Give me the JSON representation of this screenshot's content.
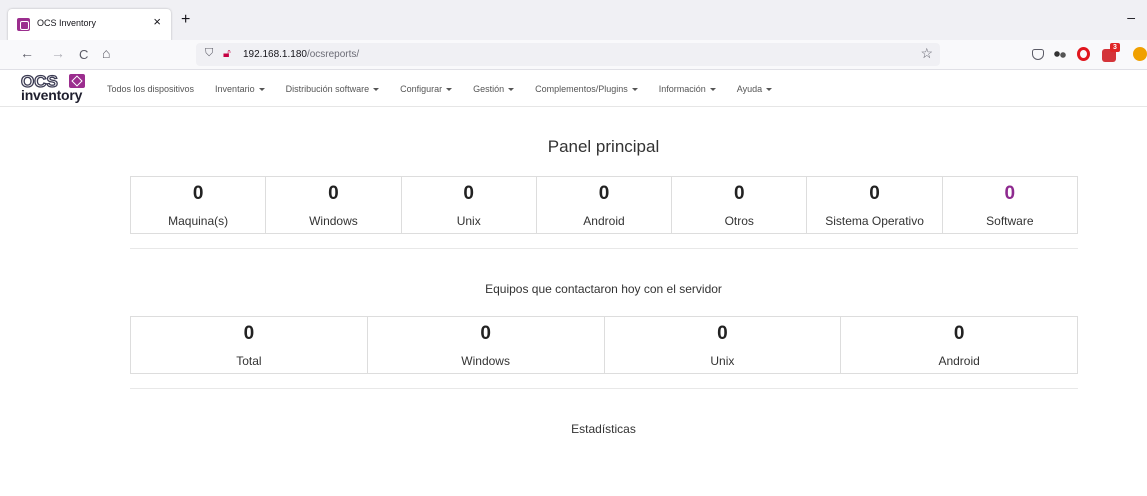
{
  "browser": {
    "tab_title": "OCS Inventory",
    "tab_close": "×",
    "new_tab": "+",
    "minimize": "–",
    "back": "←",
    "forward": "→",
    "reload": "C",
    "home": "⌂",
    "url_host": "192.168.1.180",
    "url_path": "/ocsreports/",
    "star": "☆",
    "ext_badge": "3"
  },
  "app": {
    "logo_top": "OCS",
    "logo_bottom": "inventory",
    "menu": [
      {
        "label": "Todos los dispositivos",
        "dropdown": false
      },
      {
        "label": "Inventario",
        "dropdown": true
      },
      {
        "label": "Distribución software",
        "dropdown": true
      },
      {
        "label": "Configurar",
        "dropdown": true
      },
      {
        "label": "Gestión",
        "dropdown": true
      },
      {
        "label": "Complementos/Plugins",
        "dropdown": true
      },
      {
        "label": "Información",
        "dropdown": true
      },
      {
        "label": "Ayuda",
        "dropdown": true
      }
    ]
  },
  "main": {
    "title": "Panel principal",
    "stats": [
      {
        "value": "0",
        "label": "Maquina(s)"
      },
      {
        "value": "0",
        "label": "Windows"
      },
      {
        "value": "0",
        "label": "Unix"
      },
      {
        "value": "0",
        "label": "Android"
      },
      {
        "value": "0",
        "label": "Otros"
      },
      {
        "value": "0",
        "label": "Sistema Operativo"
      },
      {
        "value": "0",
        "label": "Software"
      }
    ],
    "accent_color": "#8e2a8f",
    "today_title": "Equipos que contactaron hoy con el servidor",
    "today_stats": [
      {
        "value": "0",
        "label": "Total"
      },
      {
        "value": "0",
        "label": "Windows"
      },
      {
        "value": "0",
        "label": "Unix"
      },
      {
        "value": "0",
        "label": "Android"
      }
    ],
    "stats_title": "Estadísticas"
  }
}
